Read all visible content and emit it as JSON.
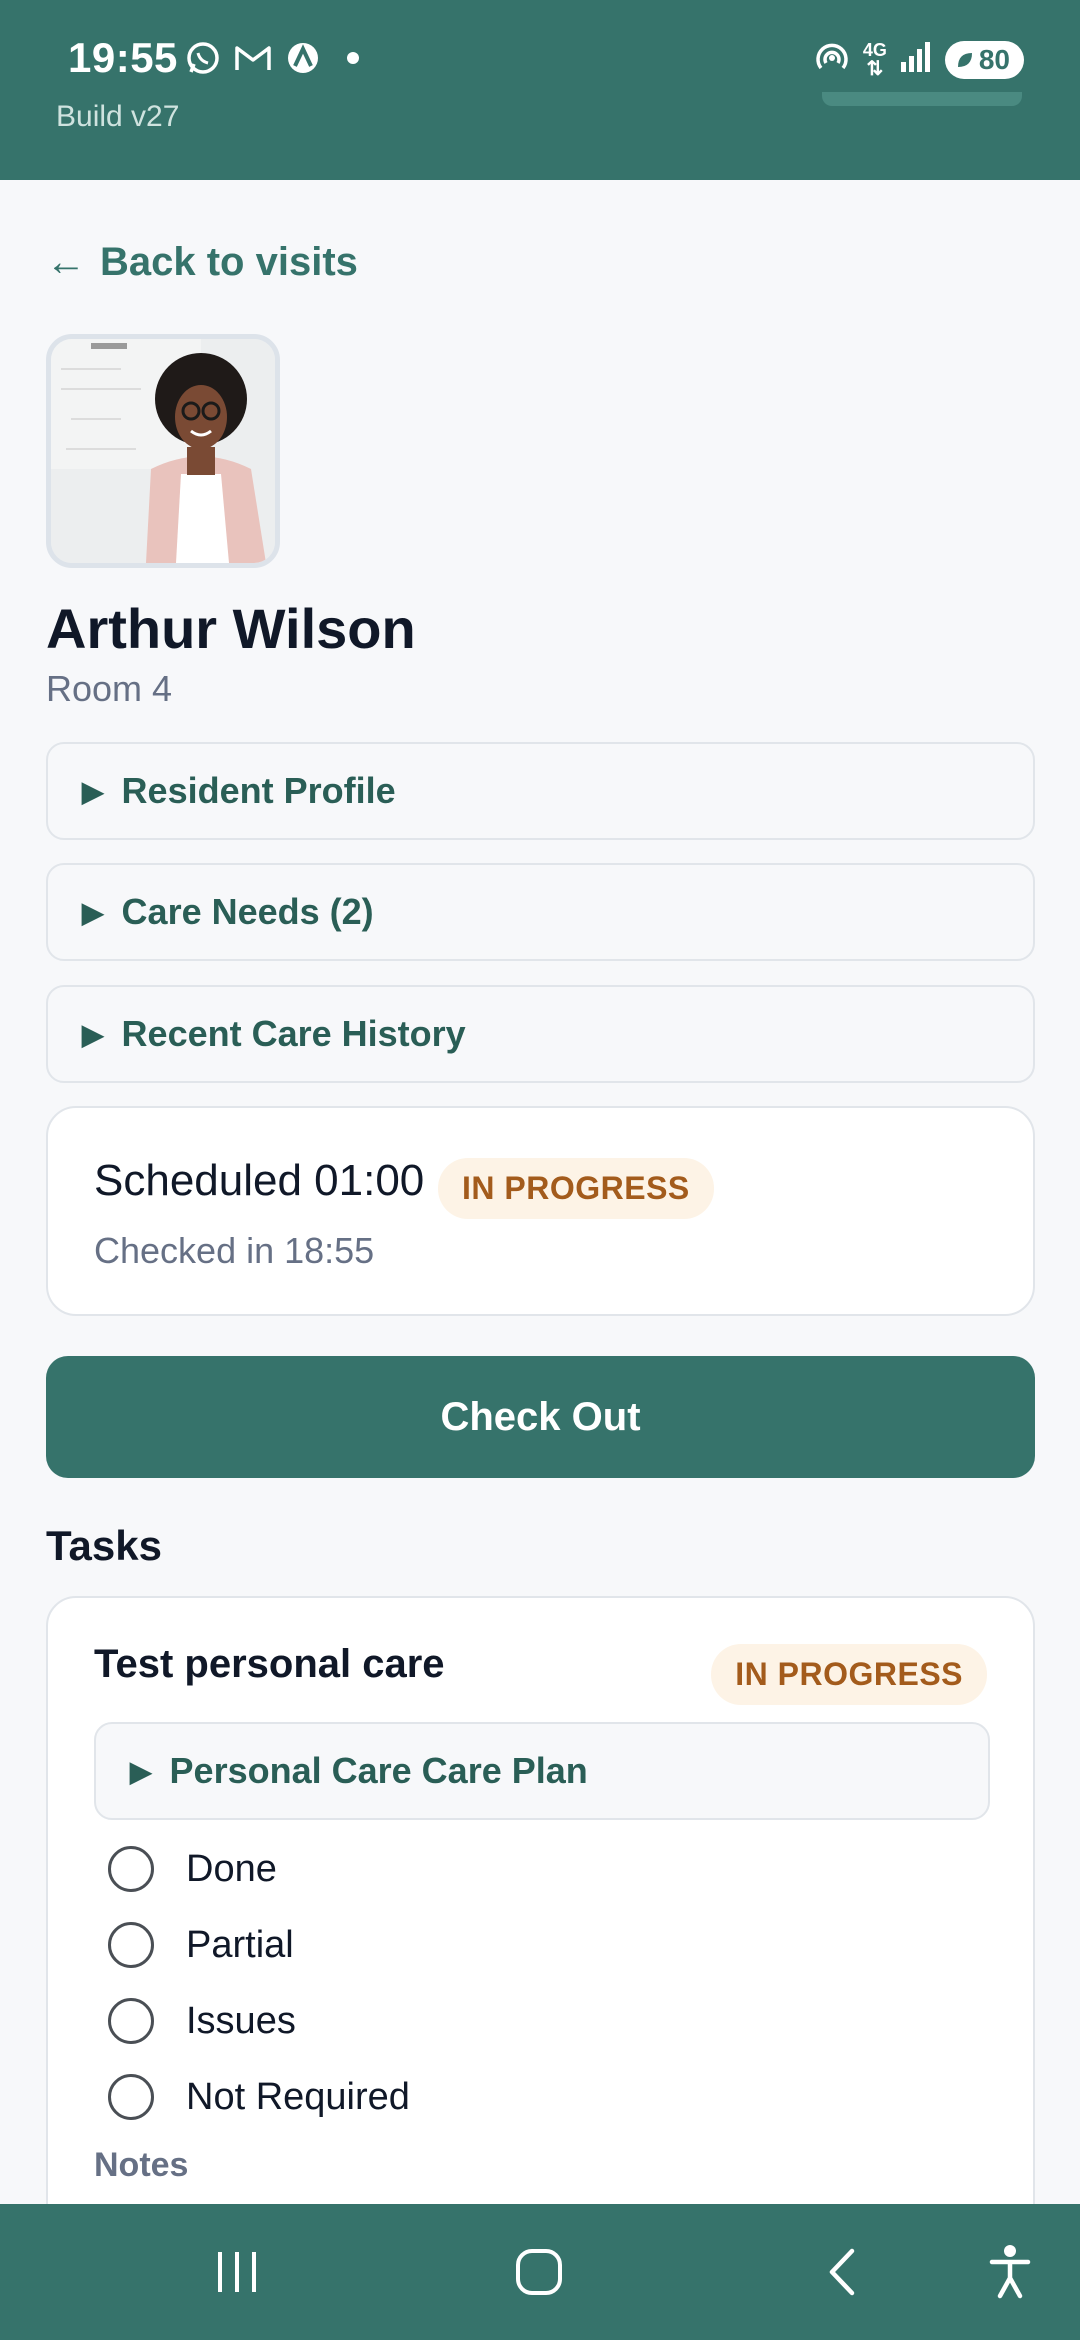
{
  "status_bar": {
    "time": "19:55",
    "build": "Build v27",
    "battery": "80",
    "network": "4G",
    "notification_icons": [
      "whatsapp-icon",
      "gmail-icon",
      "app-icon",
      "dot-icon"
    ],
    "system_icons": [
      "hotspot-icon",
      "data-arrows-icon",
      "signal-icon",
      "battery-icon"
    ]
  },
  "nav": {
    "back_label": "Back to visits"
  },
  "resident": {
    "name": "Arthur Wilson",
    "room": "Room 4"
  },
  "sections": [
    {
      "label": "Resident Profile"
    },
    {
      "label": "Care Needs (2)"
    },
    {
      "label": "Recent Care History"
    }
  ],
  "visit": {
    "scheduled": "Scheduled 01:00",
    "status": "IN PROGRESS",
    "checked_in": "Checked in 18:55"
  },
  "checkout_label": "Check Out",
  "tasks": {
    "title": "Tasks",
    "items": [
      {
        "name": "Test personal care",
        "status": "IN PROGRESS",
        "care_plan_label": "Personal Care Care Plan",
        "options": [
          "Done",
          "Partial",
          "Issues",
          "Not Required"
        ],
        "notes_label": "Notes"
      }
    ]
  },
  "colors": {
    "brand": "#36736b",
    "badge_bg": "#fdf3e6",
    "badge_text": "#a35b1c"
  },
  "system_nav": [
    "recents-icon",
    "home-icon",
    "back-icon",
    "accessibility-icon"
  ]
}
